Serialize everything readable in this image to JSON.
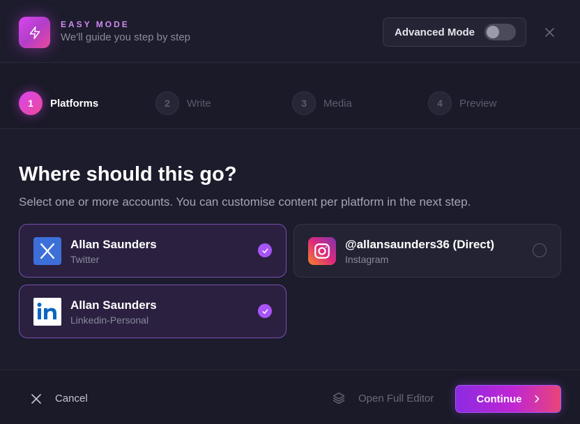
{
  "header": {
    "mode_label": "EASY MODE",
    "mode_subtitle": "We'll guide you step by step",
    "logo_icon": "lightning-icon",
    "advanced_toggle": {
      "label": "Advanced Mode",
      "checked": false
    },
    "close_icon": "close-icon"
  },
  "steps": [
    {
      "number": "1",
      "label": "Platforms",
      "active": true
    },
    {
      "number": "2",
      "label": "Write",
      "active": false
    },
    {
      "number": "3",
      "label": "Media",
      "active": false
    },
    {
      "number": "4",
      "label": "Preview",
      "active": false
    }
  ],
  "main": {
    "heading": "Where should this go?",
    "subheading": "Select one or more accounts. You can customise content per platform in the next step.",
    "accounts": [
      {
        "name": "Allan Saunders",
        "platform": "Twitter",
        "icon": "x-twitter-icon",
        "selected": true
      },
      {
        "name": "@allansaunders36 (Direct)",
        "platform": "Instagram",
        "icon": "instagram-icon",
        "selected": false
      },
      {
        "name": "Allan Saunders",
        "platform": "Linkedin-Personal",
        "icon": "linkedin-icon",
        "selected": true
      }
    ]
  },
  "footer": {
    "cancel_label": "Cancel",
    "full_editor_label": "Open Full Editor",
    "continue_label": "Continue"
  },
  "colors": {
    "background": "#1c1c2c",
    "accent_purple": "#a855f7",
    "accent_pink": "#ec4899",
    "selected_card_border": "#7a4fb0"
  }
}
